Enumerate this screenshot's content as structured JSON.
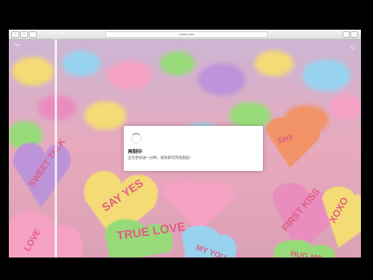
{
  "browser": {
    "url": "s.pixlr.com",
    "back_glyph": "‹",
    "forward_glyph": "›"
  },
  "editor": {
    "corner_label": "Pixlr",
    "settings_glyph": "◇"
  },
  "dialog": {
    "title": "再制中",
    "message": "正在尝试进一分钟，很快即可完成图层！"
  },
  "candies": [
    {
      "text": "SAY YES",
      "color": "#f3d86a"
    },
    {
      "text": "TRUE LOVE",
      "color": "#8fd86e"
    },
    {
      "text": "FIRST KISS",
      "color": "#e784b9"
    },
    {
      "text": "XOXO",
      "color": "#f3d86a"
    },
    {
      "text": "SWEET TALK",
      "color": "#b88ad6"
    },
    {
      "text": "MY YOU",
      "color": "#8fd0ee"
    },
    {
      "text": "HUG ME",
      "color": "#8fd86e"
    },
    {
      "text": "LOVE",
      "color": "#f59abf"
    },
    {
      "text": "SHY",
      "color": "#f08a5a"
    }
  ],
  "colors": {
    "letterbox": "#000000",
    "dialog_bg": "#ffffff",
    "candy_text": "#e0507a"
  }
}
